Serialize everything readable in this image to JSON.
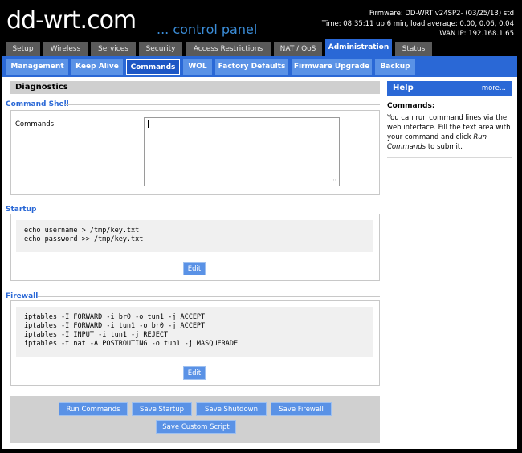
{
  "header": {
    "logo_text": "dd-wrt",
    "logo_suffix": ".com",
    "tagline": "... control panel",
    "firmware": "Firmware: DD-WRT v24SP2- (03/25/13) std",
    "time": "Time: 08:35:11 up 6 min, load average: 0.00, 0.06, 0.04",
    "wan_ip": "WAN IP: 192.168.1.65"
  },
  "main_tabs": [
    {
      "label": "Setup"
    },
    {
      "label": "Wireless"
    },
    {
      "label": "Services"
    },
    {
      "label": "Security"
    },
    {
      "label": "Access Restrictions"
    },
    {
      "label": "NAT / QoS"
    },
    {
      "label": "Administration",
      "active": true
    },
    {
      "label": "Status"
    }
  ],
  "sub_tabs": [
    {
      "label": "Management"
    },
    {
      "label": "Keep Alive"
    },
    {
      "label": "Commands",
      "active": true
    },
    {
      "label": "WOL"
    },
    {
      "label": "Factory Defaults"
    },
    {
      "label": "Firmware Upgrade"
    },
    {
      "label": "Backup"
    }
  ],
  "diagnostics_title": "Diagnostics",
  "command_shell": {
    "title": "Command Shell",
    "label": "Commands",
    "value": ""
  },
  "startup": {
    "title": "Startup",
    "code": "echo username > /tmp/key.txt\necho password >> /tmp/key.txt",
    "edit_label": "Edit"
  },
  "firewall": {
    "title": "Firewall",
    "code": "iptables -I FORWARD -i br0 -o tun1 -j ACCEPT\niptables -I FORWARD -i tun1 -o br0 -j ACCEPT\niptables -I INPUT -i tun1 -j REJECT\niptables -t nat -A POSTROUTING -o tun1 -j MASQUERADE",
    "edit_label": "Edit"
  },
  "buttons": {
    "run_commands": "Run Commands",
    "save_startup": "Save Startup",
    "save_shutdown": "Save Shutdown",
    "save_firewall": "Save Firewall",
    "save_custom_script": "Save Custom Script"
  },
  "help": {
    "title": "Help",
    "more": "more...",
    "subtitle": "Commands:",
    "text_before": "You can run command lines via the web interface. Fill the text area with your command and click ",
    "text_em": "Run Commands",
    "text_after": " to submit."
  },
  "colors": {
    "accent": "#2a68d6",
    "tab_inactive": "#5a5a5a",
    "subtab": "#5a92e6",
    "section_title": "#2a68d6"
  }
}
